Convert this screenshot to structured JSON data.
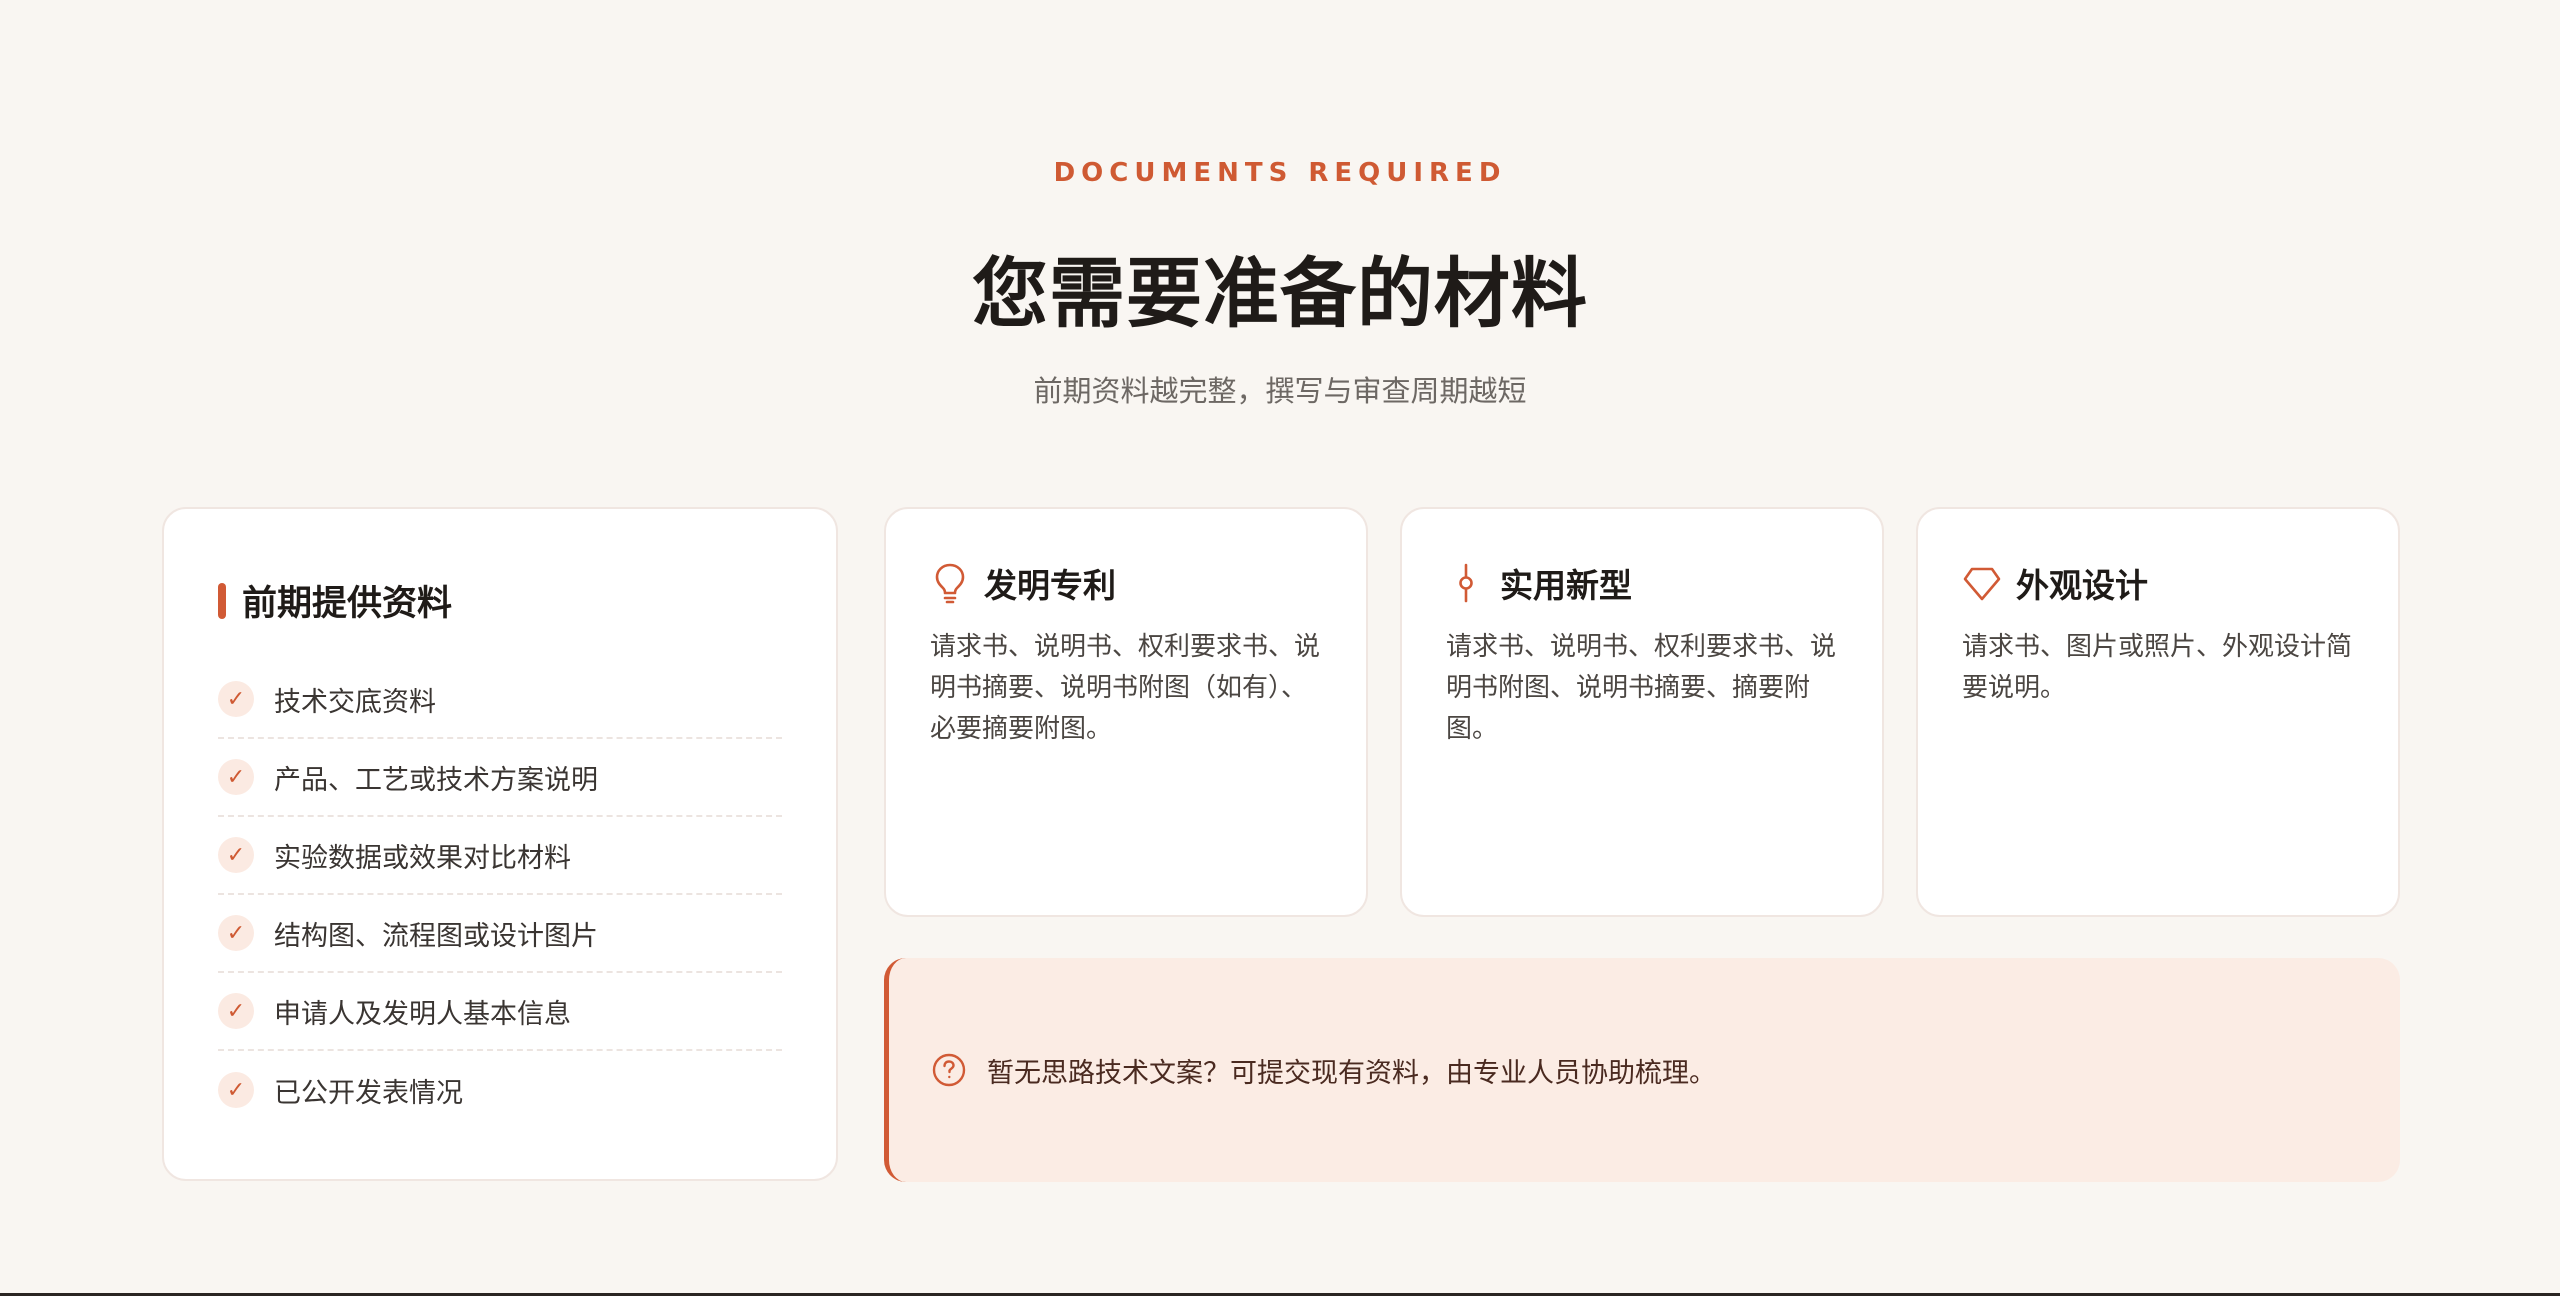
{
  "header": {
    "eyebrow": "DOCUMENTS REQUIRED",
    "title": "您需要准备的材料",
    "subtitle": "前期资料越完整，撰写与审查周期越短"
  },
  "prep_card": {
    "title": "前期提供资料",
    "check_icon": "✓",
    "items": [
      "技术交底资料",
      "产品、工艺或技术方案说明",
      "实验数据或效果对比材料",
      "结构图、流程图或设计图片",
      "申请人及发明人基本信息",
      "已公开发表情况"
    ]
  },
  "categories": [
    {
      "icon": "lightbulb-icon",
      "title": "发明专利",
      "desc": "请求书、说明书、权利要求书、说明书摘要、说明书附图（如有）、必要摘要附图。"
    },
    {
      "icon": "commit-node-icon",
      "title": "实用新型",
      "desc": "请求书、说明书、权利要求书、说明书附图、说明书摘要、摘要附图。"
    },
    {
      "icon": "diamond-icon",
      "title": "外观设计",
      "desc": "请求书、图片或照片、外观设计简要说明。"
    }
  ],
  "tip": {
    "icon": "question-circle-icon",
    "text": "暂无思路技术文案？可提交现有资料，由专业人员协助梳理。"
  },
  "colors": {
    "accent": "#d15a35",
    "background": "#f9f6f2",
    "tip_background": "#fbece4"
  }
}
